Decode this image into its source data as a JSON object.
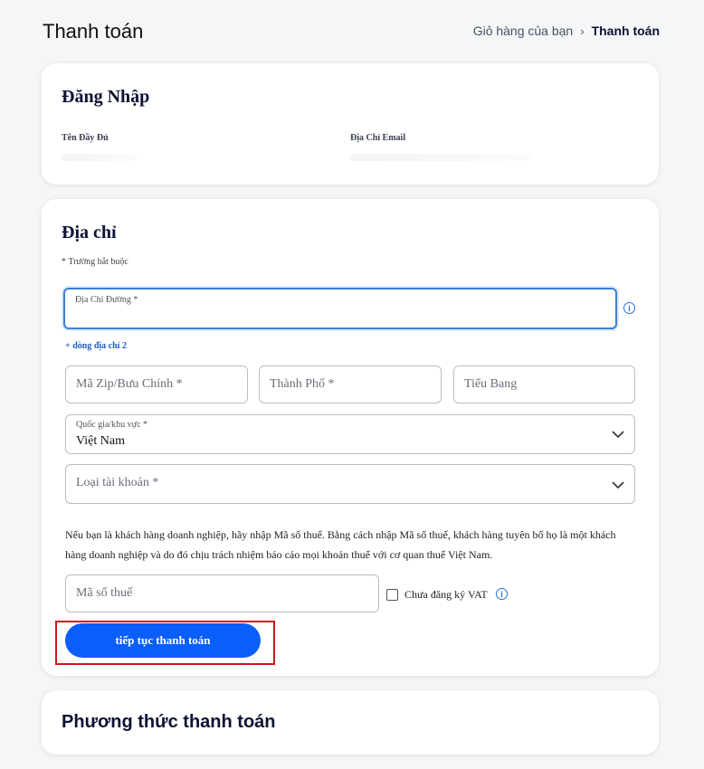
{
  "page_title": "Thanh toán",
  "breadcrumb": {
    "cart": "Giỏ hàng của bạn",
    "separator": "›",
    "current": "Thanh toán"
  },
  "login": {
    "heading": "Đăng Nhập",
    "full_name_label": "Tên Đầy Đủ",
    "email_label": "Địa Chỉ Email"
  },
  "address": {
    "heading": "Địa chỉ",
    "required_note": "* Trường bắt buộc",
    "street_label": "Địa Chỉ Đường *",
    "add_line": "+ dòng địa chỉ 2",
    "zip_placeholder": "Mã Zip/Bưu Chính *",
    "city_placeholder": "Thành Phố *",
    "state_placeholder": "Tiểu Bang",
    "country_label": "Quốc gia/khu vực *",
    "country_value": "Việt Nam",
    "account_type_placeholder": "Loại tài khoản *",
    "tax_note": "Nếu bạn là khách hàng doanh nghiệp, hãy nhập Mã số thuế. Bằng cách nhập Mã số thuế, khách hàng tuyên bố họ là một khách hàng doanh nghiệp và do đó chịu trách nhiệm báo cáo mọi khoản thuế với cơ quan thuế Việt Nam.",
    "tax_id_placeholder": "Mã số thuế",
    "vat_checkbox_label": "Chưa đăng ký VAT",
    "continue_button": "tiếp tục thanh toán"
  },
  "payment": {
    "heading": "Phương thức thanh toán"
  },
  "colors": {
    "primary": "#0a5ffb",
    "heading": "#0c1232",
    "focus_border": "#3b7fd6",
    "highlight": "#d6121b"
  }
}
